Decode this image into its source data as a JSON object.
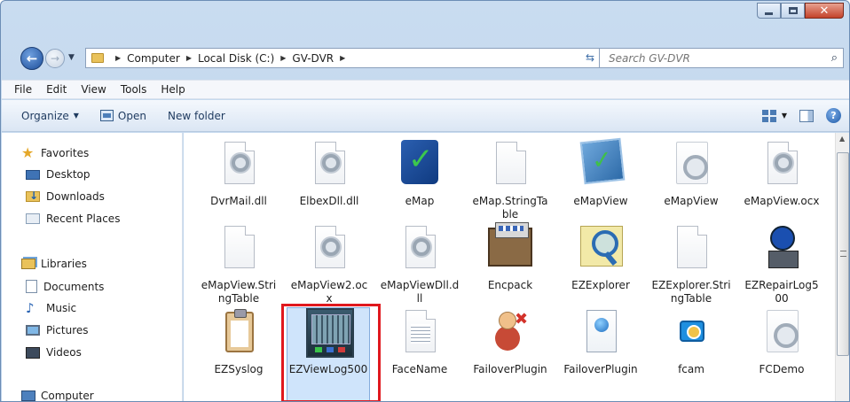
{
  "address": {
    "crumbs": [
      "Computer",
      "Local Disk (C:)",
      "GV-DVR"
    ]
  },
  "search": {
    "placeholder": "Search GV-DVR"
  },
  "menu": [
    "File",
    "Edit",
    "View",
    "Tools",
    "Help"
  ],
  "commands": {
    "organize": "Organize",
    "open": "Open",
    "new_folder": "New folder"
  },
  "nav": {
    "favorites": "Favorites",
    "desktop": "Desktop",
    "downloads": "Downloads",
    "recent": "Recent Places",
    "libraries": "Libraries",
    "documents": "Documents",
    "music": "Music",
    "pictures": "Pictures",
    "videos": "Videos",
    "computer": "Computer"
  },
  "files": [
    {
      "name": "DvrMail.dll",
      "icon": "dll-gear-icon"
    },
    {
      "name": "ElbexDll.dll",
      "icon": "dll-gear-icon"
    },
    {
      "name": "eMap",
      "icon": "emap-app-icon"
    },
    {
      "name": "eMap.StringTable",
      "icon": "blank-file-icon"
    },
    {
      "name": "eMapView",
      "icon": "emapview-app-icon"
    },
    {
      "name": "eMapView",
      "icon": "config-file-icon"
    },
    {
      "name": "eMapView.ocx",
      "icon": "dll-gear-icon"
    },
    {
      "name": "eMapView.StringTable",
      "icon": "blank-file-icon"
    },
    {
      "name": "eMapView2.ocx",
      "icon": "dll-gear-icon"
    },
    {
      "name": "eMapViewDll.dll",
      "icon": "dll-gear-icon"
    },
    {
      "name": "Encpack",
      "icon": "encpack-app-icon"
    },
    {
      "name": "EZExplorer",
      "icon": "ezexplorer-app-icon"
    },
    {
      "name": "EZExplorer.StringTable",
      "icon": "blank-file-icon"
    },
    {
      "name": "EZRepairLog500",
      "icon": "ezrepair-app-icon"
    },
    {
      "name": "EZSyslog",
      "icon": "clipboard-app-icon"
    },
    {
      "name": "EZViewLog500",
      "icon": "ezviewlog-app-icon",
      "selected": true
    },
    {
      "name": "FaceName",
      "icon": "text-file-icon"
    },
    {
      "name": "FailoverPlugin",
      "icon": "failover-app-icon"
    },
    {
      "name": "FailoverPlugin",
      "icon": "failover-config-icon"
    },
    {
      "name": "fcam",
      "icon": "fcam-app-icon"
    },
    {
      "name": "FCDemo",
      "icon": "config-file-icon"
    }
  ],
  "colors": {
    "highlight": "#e0181e",
    "selection": "#cfe4fb"
  }
}
